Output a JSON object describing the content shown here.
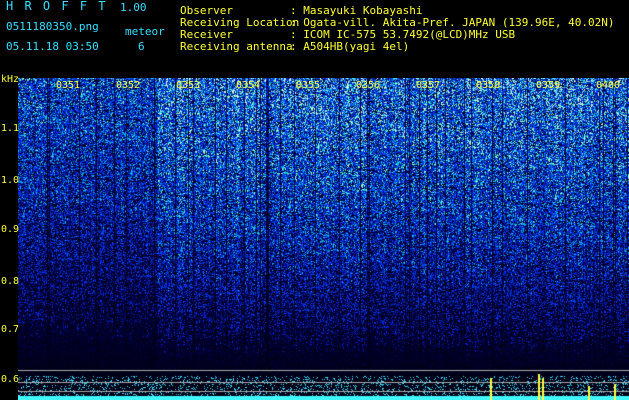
{
  "header": {
    "program": "H R O F F T",
    "version": "1.00",
    "filename": "0511180350.png",
    "mode": "meteor",
    "datetime": "05.11.18 03:50",
    "count": "6",
    "labels": [
      "Observer",
      "Receiving Location",
      "Receiver",
      "Receiving antenna"
    ],
    "values": [
      ": Masayuki Kobayashi",
      ": Ogata-vill. Akita-Pref. JAPAN (139.96E, 40.02N)",
      ": ICOM IC-575 53.7492(@LCD)MHz USB",
      ": A504HB(yagi 4el)"
    ]
  },
  "axis": {
    "unit": "kHz",
    "time_ticks": [
      "0351",
      "0352",
      "0353",
      "0354",
      "0355",
      "0356",
      "0357",
      "0358",
      "0359",
      "0400"
    ],
    "freq_ticks": [
      "1.1",
      "1.0",
      "0.9",
      "0.8",
      "0.7",
      "0.6"
    ]
  },
  "colors": {
    "noise_low": "#0000a0",
    "noise_mid": "#1e64ff",
    "noise_high": "#40ffd0",
    "signal": "#ffff40",
    "text_green": "#33ff33",
    "text_cyan": "#33e0ff",
    "text_yellow": "#ffff33"
  }
}
